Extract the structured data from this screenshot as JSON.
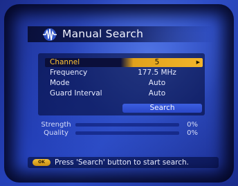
{
  "title": "Manual Search",
  "fields": [
    {
      "label": "Channel",
      "value": "5",
      "selected": true
    },
    {
      "label": "Frequency",
      "value": "177.5 MHz"
    },
    {
      "label": "Mode",
      "value": "Auto"
    },
    {
      "label": "Guard Interval",
      "value": "Auto"
    }
  ],
  "search_button": "Search",
  "signal": [
    {
      "label": "Strength",
      "percent_text": "0%",
      "level": 0
    },
    {
      "label": "Quality",
      "percent_text": "0%",
      "level": 0
    }
  ],
  "hint": {
    "key": "OK",
    "text": "Press 'Search' button to start search."
  },
  "colors": {
    "accent": "#f2b52a",
    "background": "#2440b8"
  }
}
